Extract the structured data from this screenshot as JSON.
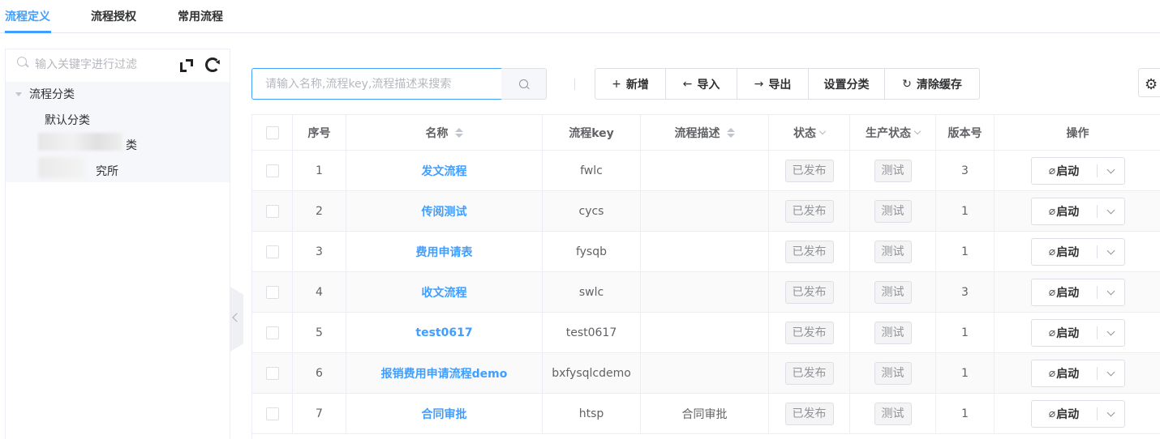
{
  "tabs": [
    {
      "label": "流程定义",
      "active": true
    },
    {
      "label": "流程授权",
      "active": false
    },
    {
      "label": "常用流程",
      "active": false
    }
  ],
  "left_panel": {
    "search_placeholder": "输入关键字进行过滤",
    "tree": {
      "root": "流程分类",
      "children": [
        "默认分类",
        "类",
        "究所"
      ]
    }
  },
  "toolbar": {
    "search_placeholder": "请输入名称,流程key,流程描述来搜索",
    "buttons": [
      {
        "icon": "+",
        "label": "新增"
      },
      {
        "icon": "←",
        "label": "导入"
      },
      {
        "icon": "→",
        "label": "导出"
      },
      {
        "icon": "",
        "label": "设置分类"
      },
      {
        "icon": "↻",
        "label": "清除缓存"
      }
    ]
  },
  "table": {
    "headers": {
      "index": "序号",
      "name": "名称",
      "key": "流程key",
      "desc": "流程描述",
      "status": "状态",
      "prod_status": "生产状态",
      "version": "版本号",
      "ops": "操作"
    },
    "rows": [
      {
        "index": "1",
        "name": "发文流程",
        "key": "fwlc",
        "desc": "",
        "status": "已发布",
        "prod_status": "测试",
        "version": "3",
        "op": "启动"
      },
      {
        "index": "2",
        "name": "传阅测试",
        "key": "cycs",
        "desc": "",
        "status": "已发布",
        "prod_status": "测试",
        "version": "1",
        "op": "启动"
      },
      {
        "index": "3",
        "name": "费用申请表",
        "key": "fysqb",
        "desc": "",
        "status": "已发布",
        "prod_status": "测试",
        "version": "1",
        "op": "启动"
      },
      {
        "index": "4",
        "name": "收文流程",
        "key": "swlc",
        "desc": "",
        "status": "已发布",
        "prod_status": "测试",
        "version": "3",
        "op": "启动"
      },
      {
        "index": "5",
        "name": "test0617",
        "key": "test0617",
        "desc": "",
        "status": "已发布",
        "prod_status": "测试",
        "version": "1",
        "op": "启动"
      },
      {
        "index": "6",
        "name": "报销费用申请流程demo",
        "key": "bxfysqlcdemo",
        "desc": "",
        "status": "已发布",
        "prod_status": "测试",
        "version": "1",
        "op": "启动"
      },
      {
        "index": "7",
        "name": "合同审批",
        "key": "htsp",
        "desc": "合同审批",
        "status": "已发布",
        "prod_status": "测试",
        "version": "1",
        "op": "启动"
      }
    ]
  },
  "colors": {
    "accent": "#409eff",
    "border": "#ebeef5",
    "tag_bg": "#f4f4f5"
  }
}
